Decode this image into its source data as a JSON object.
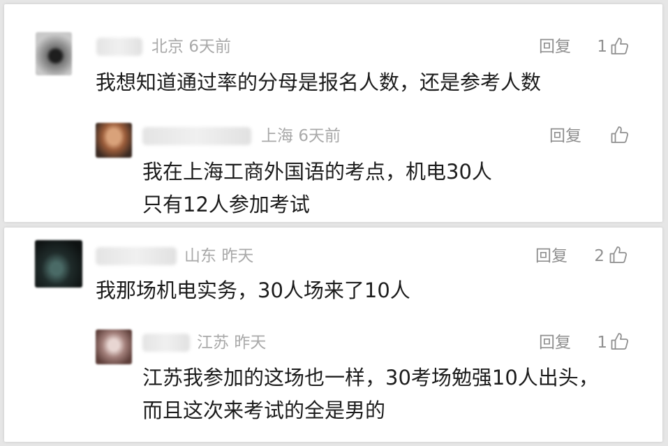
{
  "comments": [
    {
      "location": "北京",
      "time": "6天前",
      "reply": "回复",
      "likes": "1",
      "text": "我想知道通过率的分母是报名人数，还是参考人数",
      "reply_item": {
        "location": "上海",
        "time": "6天前",
        "reply": "回复",
        "likes": "",
        "text": "我在上海工商外国语的考点，机电30人只有12人参加考试"
      }
    },
    {
      "location": "山东",
      "time": "昨天",
      "reply": "回复",
      "likes": "2",
      "text": "我那场机电实务，30人场来了10人",
      "reply_item": {
        "location": "江苏",
        "time": "昨天",
        "reply": "回复",
        "likes": "1",
        "text": "江苏我参加的这场也一样，30考场勉强10人出头，而且这次来考试的全是男的"
      }
    }
  ],
  "icons": {
    "like": "thumbs-up-icon"
  },
  "colors": {
    "meta": "#a9a9a9",
    "text": "#1c1c1c",
    "action": "#8f8f8f"
  }
}
